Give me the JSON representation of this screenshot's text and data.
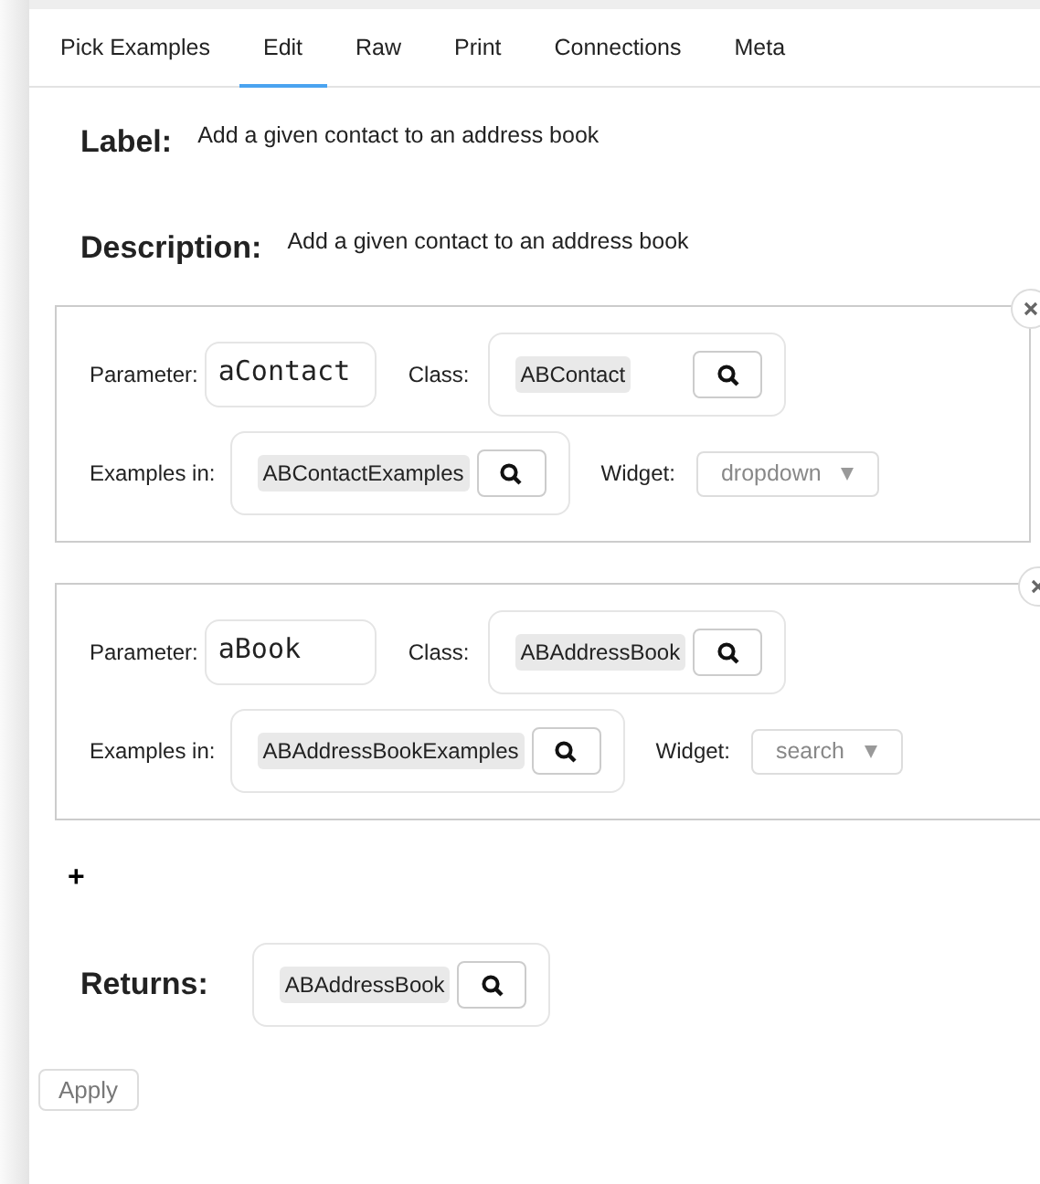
{
  "tabs": [
    {
      "label": "Pick Examples",
      "selected": false
    },
    {
      "label": "Edit",
      "selected": true
    },
    {
      "label": "Raw",
      "selected": false
    },
    {
      "label": "Print",
      "selected": false
    },
    {
      "label": "Connections",
      "selected": false
    },
    {
      "label": "Meta",
      "selected": false
    }
  ],
  "label": {
    "title": "Label:",
    "value": "Add a given contact to an address book"
  },
  "description": {
    "title": "Description:",
    "value": "Add a given contact to an address book"
  },
  "parameters": [
    {
      "parameter_label": "Parameter:",
      "name": "aContact",
      "class_label": "Class:",
      "class": "ABContact",
      "examples_label": "Examples in:",
      "examples": "ABContactExamples",
      "widget_label": "Widget:",
      "widget": "dropdown"
    },
    {
      "parameter_label": "Parameter:",
      "name": "aBook",
      "class_label": "Class:",
      "class": "ABAddressBook",
      "examples_label": "Examples in:",
      "examples": "ABAddressBookExamples",
      "widget_label": "Widget:",
      "widget": "search"
    }
  ],
  "add_button": "+",
  "returns": {
    "title": "Returns:",
    "class": "ABAddressBook"
  },
  "apply_button": "Apply"
}
